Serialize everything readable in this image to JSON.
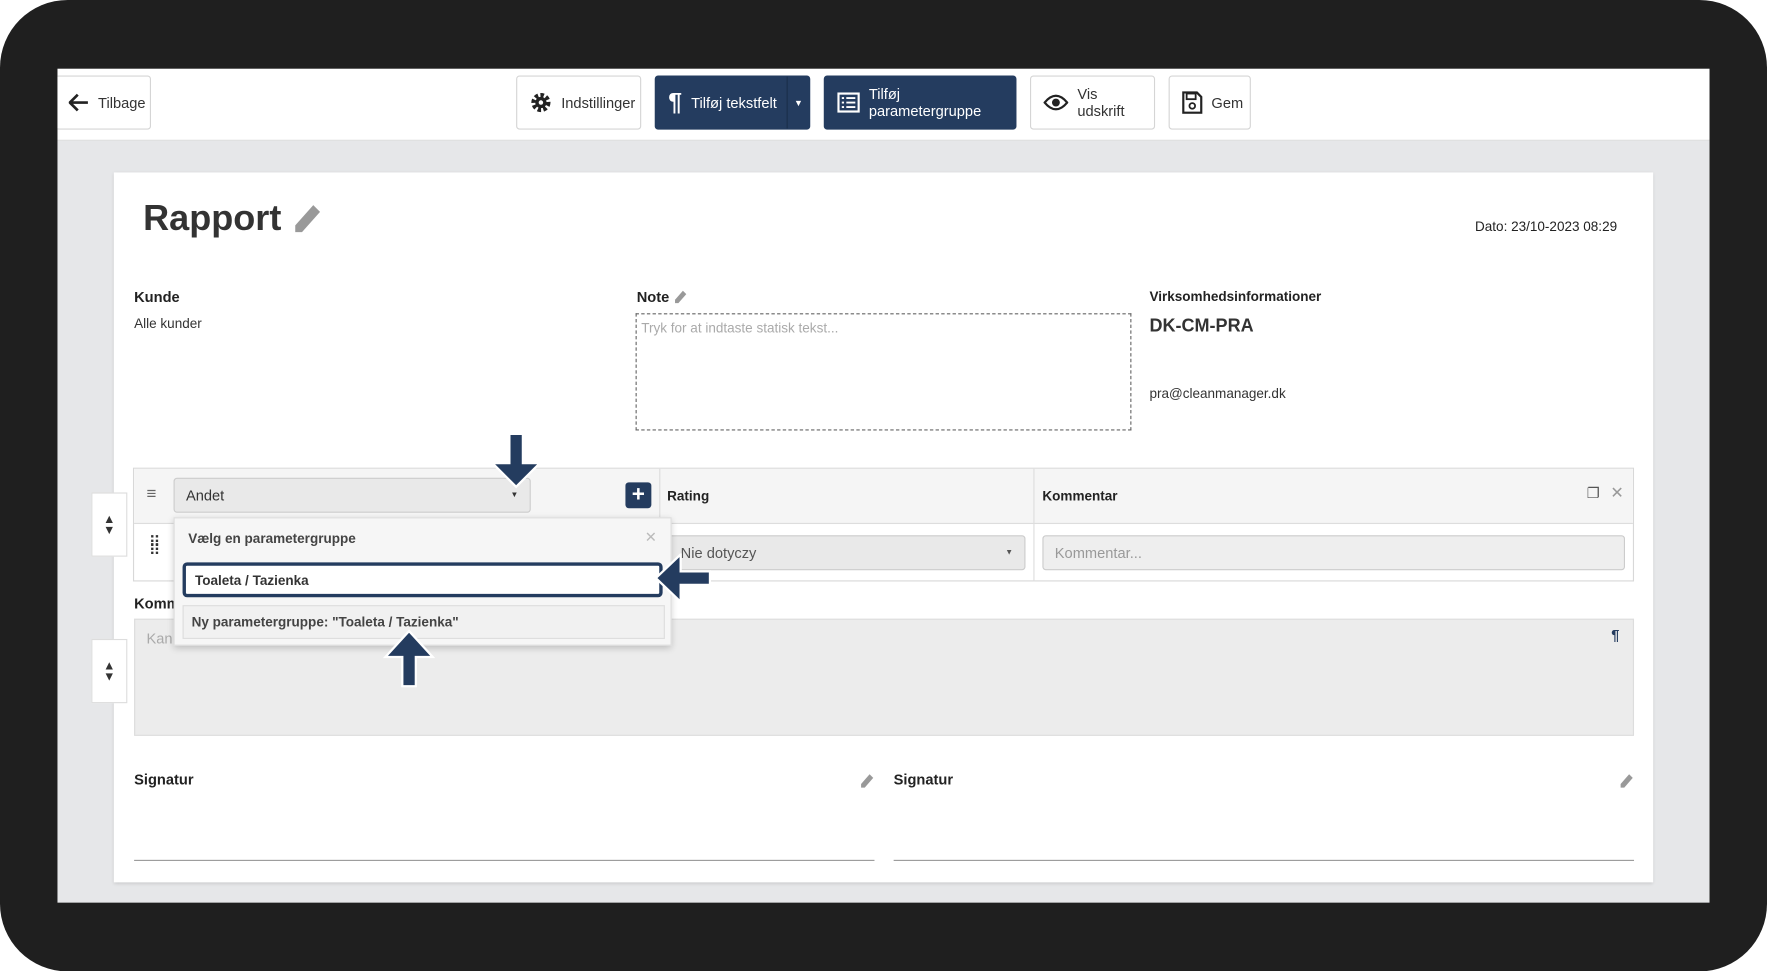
{
  "toolbar": {
    "back_label": "Tilbage",
    "settings_label": "Indstillinger",
    "add_textfield_label": "Tilføj tekstfelt",
    "add_paramgroup_label": "Tilføj parametergruppe",
    "preview_label": "Vis udskrift",
    "save_label": "Gem"
  },
  "report": {
    "title": "Rapport",
    "date": "Dato: 23/10-2023 08:29",
    "customer_label": "Kunde",
    "customer_value": "Alle kunder",
    "note_label": "Note",
    "note_placeholder": "Tryk for at indtaste statisk tekst...",
    "company_label": "Virksomhedsinformationer",
    "company_name": "DK-CM-PRA",
    "company_email": "pra@cleanmanager.dk"
  },
  "param_table": {
    "group_select": "Andet",
    "col_rating": "Rating",
    "col_comment": "Kommentar",
    "rating_value": "Nie dotyczy",
    "comment_placeholder": "Kommentar..."
  },
  "dropdown": {
    "header": "Vælg en parametergruppe",
    "search_value": "Toaleta / Tazienka",
    "new_option": "Ny parametergruppe: \"Toaleta / Tazienka\""
  },
  "comment_section": {
    "label": "Komm",
    "placeholder": "Kan"
  },
  "signatures": {
    "left_label": "Signatur",
    "right_label": "Signatur"
  },
  "colors": {
    "accent": "#243c5f",
    "callout_arrow": "#243c5f"
  }
}
